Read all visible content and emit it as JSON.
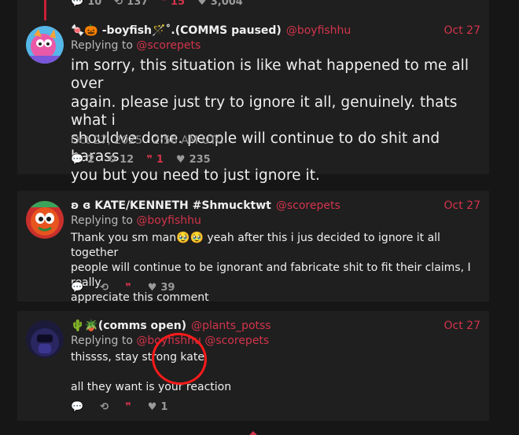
{
  "colors": {
    "accent": "#d2344b",
    "card": "#1f1f1f",
    "page": "#161616"
  },
  "top_stats": {
    "replies": "10",
    "reposts": "137",
    "quotes": "15",
    "likes": "3,004"
  },
  "posts": [
    {
      "name": "🍬🎃 -boyfish🪄˚.(COMMS paused)",
      "handle": "@boyfishhu",
      "date": "Oct 27",
      "replying_label": "Replying to",
      "replying_to": [
        "@scorepets"
      ],
      "text_lines": [
        "im sorry, this situation is like what happened to me all over",
        "again. please just try to ignore it all, genuinely. thats what i",
        "shouldve done. people will continue to do shit and harass",
        "you but you need to just ignore it."
      ],
      "timestamp": "Oct 27, 2025 · 2:56 AM UTC",
      "stats": {
        "replies": "2",
        "reposts": "12",
        "quotes": "1",
        "likes": "235"
      }
    },
    {
      "name": "ʚ ɞ KATE/KENNETH #Shmucktwt",
      "handle": "@scorepets",
      "date": "Oct 27",
      "replying_label": "Replying to",
      "replying_to": [
        "@boyfishhu"
      ],
      "text_lines": [
        "Thank you sm man🥹🥹 yeah after this i jus decided to ignore it all together",
        "people will continue to be ignorant and fabricate shit to fit their claims, I really",
        "appreciate this comment"
      ],
      "stats": {
        "replies": "",
        "reposts": "",
        "quotes": "",
        "likes": "39"
      }
    },
    {
      "name": "🌵🪴(comms open)",
      "handle": "@plants_potss",
      "date": "Oct 27",
      "replying_label": "Replying to",
      "replying_to": [
        "@boyfishhu",
        "@scorepets"
      ],
      "text_lines": [
        "thissss, stay strong kate",
        "",
        "all they want is your reaction"
      ],
      "stats": {
        "replies": "",
        "reposts": "",
        "quotes": "",
        "likes": "1"
      }
    }
  ],
  "icons": [
    "comment-icon",
    "repost-icon",
    "quote-icon",
    "heart-icon"
  ]
}
